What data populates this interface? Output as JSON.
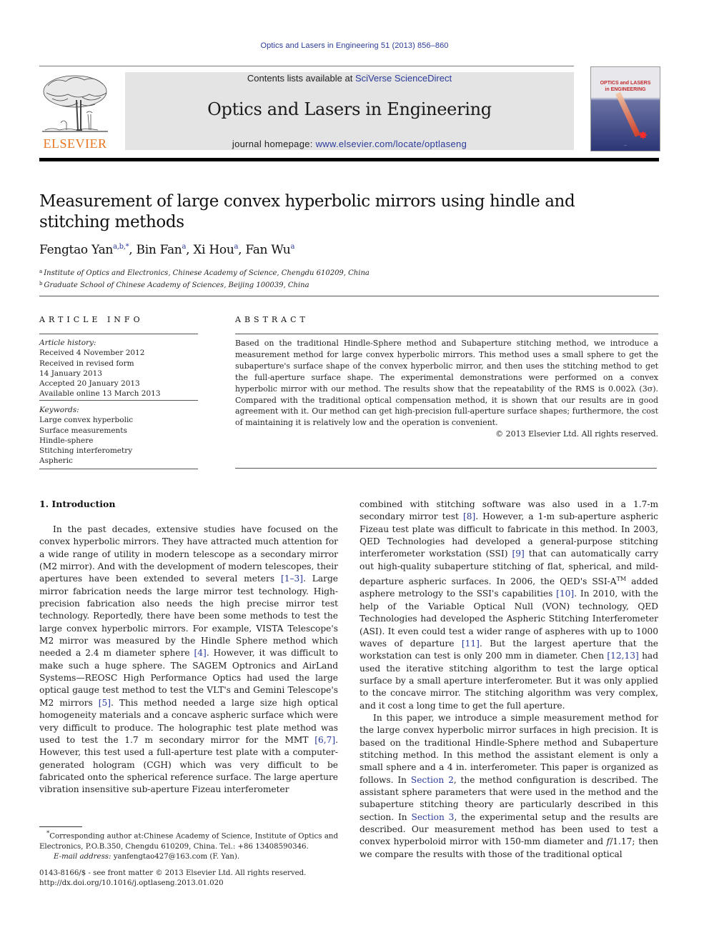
{
  "header": {
    "running_head": "Optics and Lasers in Engineering 51 (2013) 856–860",
    "publisher_logo_text": "ELSEVIER",
    "contents_prefix": "Contents lists available at ",
    "contents_link": "SciVerse ScienceDirect",
    "journal_title": "Optics and Lasers in Engineering",
    "homepage_prefix": "journal homepage: ",
    "homepage_link": "www.elsevier.com/locate/optlaseng",
    "cover": {
      "title_line1": "OPTICS and LASERS",
      "title_line2": "in ENGINEERING",
      "star_icon": "✸"
    },
    "colors": {
      "link": "#2a3a9a",
      "elsevier_orange": "#e87722",
      "banner_bg": "#e4e4e4"
    }
  },
  "article": {
    "title": "Measurement of large convex hyperbolic mirrors using hindle and stitching methods",
    "authors": [
      {
        "name": "Fengtao Yan",
        "sup": "a,b,",
        "star": "*"
      },
      {
        "name": "Bin Fan",
        "sup": "a"
      },
      {
        "name": "Xi Hou",
        "sup": "a"
      },
      {
        "name": "Fan Wu",
        "sup": "a"
      }
    ],
    "affiliations": [
      {
        "mark": "a",
        "text": "Institute of Optics and Electronics, Chinese Academy of Science, Chengdu 610209, China"
      },
      {
        "mark": "b",
        "text": "Graduate School of Chinese Academy of Sciences, Beijing 100039, China"
      }
    ]
  },
  "article_info": {
    "heading": "ARTICLE INFO",
    "history_label": "Article history:",
    "history": [
      "Received 4 November 2012",
      "Received in revised form",
      "14 January 2013",
      "Accepted 20 January 2013",
      "Available online 13 March 2013"
    ],
    "keywords_label": "Keywords:",
    "keywords": [
      "Large convex hyperbolic",
      "Surface measurements",
      "Hindle-sphere",
      "Stitching interferometry",
      "Aspheric"
    ]
  },
  "abstract": {
    "heading": "ABSTRACT",
    "text": "Based on the traditional Hindle-Sphere method and Subaperture stitching method, we introduce a measurement method for large convex hyperbolic mirrors. This method uses a small sphere to get the subaperture's surface shape of the convex hyperbolic mirror, and then uses the stitching method to get the full-aperture surface shape. The experimental demonstrations were performed on a convex hyperbolic mirror with our method. The results show that the repeatability of the RMS is 0.002λ (3σ). Compared with the traditional optical compensation method, it is shown that our results are in good agreement with it. Our method can get high-precision full-aperture surface shapes; furthermore, the cost of maintaining it is relatively low and the operation is convenient.",
    "copyright": "© 2013 Elsevier Ltd. All rights reserved."
  },
  "body": {
    "section_heading": "1.  Introduction",
    "left_column": [
      {
        "t": "In the past decades, extensive studies have focused on the convex hyperbolic mirrors. They have attracted much attention for a wide range of utility in modern telescope as a secondary mirror (M2 mirror). And with the development of modern telescopes, their apertures have been extended to several meters "
      },
      {
        "ref": "[1–3]"
      },
      {
        "t": ". Large mirror fabrication needs the large mirror test technology. High-precision fabrication also needs the high precise mirror test technology. Reportedly, there have been some methods to test the large convex hyperbolic mirrors. For example, VISTA Telescope's M2 mirror was measured by the Hindle Sphere method which needed a 2.4 m diameter sphere "
      },
      {
        "ref": "[4]"
      },
      {
        "t": ". However, it was difficult to make such a huge sphere. The SAGEM Optronics and AirLand Systems—REOSC High Performance Optics had used the large optical gauge test method to test the VLT's and Gemini Telescope's M2 mirrors "
      },
      {
        "ref": "[5]"
      },
      {
        "t": ". This method needed a large size high optical homogeneity materials and a concave aspheric surface which were very difficult to produce. The holographic test plate method was used to test the 1.7 m secondary mirror for the MMT "
      },
      {
        "ref": "[6,7]"
      },
      {
        "t": ". However, this test used a full-aperture test plate with a computer-generated hologram (CGH) which was very difficult to be fabricated onto the spherical reference surface. The large aperture vibration insensitive sub-aperture Fizeau interferometer"
      }
    ],
    "right_para1": [
      {
        "t": "combined with stitching software was also used in a 1.7-m secondary mirror test "
      },
      {
        "ref": "[8]"
      },
      {
        "t": ". However, a 1-m sub-aperture aspheric Fizeau test plate was difficult to fabricate in this method. In 2003, QED Technologies had developed a general-purpose stitching interferometer workstation (SSI) "
      },
      {
        "ref": "[9]"
      },
      {
        "t": " that can automatically carry out high-quality subaperture stitching of flat, spherical, and mild-departure aspheric surfaces. In 2006, the QED's SSI-A"
      },
      {
        "sup": "TM"
      },
      {
        "t": " added asphere metrology to the SSI's capabilities "
      },
      {
        "ref": "[10]"
      },
      {
        "t": ". In 2010, with the help of the Variable Optical Null (VON) technology, QED Technologies had developed the Aspheric Stitching Interferometer (ASI). It even could test a wider range of aspheres with up to 1000 waves of departure "
      },
      {
        "ref": "[11]"
      },
      {
        "t": ". But the largest aperture that the workstation can test is only 200 mm in diameter. Chen "
      },
      {
        "ref": "[12,13]"
      },
      {
        "t": " had used the iterative stitching algorithm to test the large optical surface by a small aperture interferometer. But it was only applied to the concave mirror. The stitching algorithm was very complex, and it cost a long time to get the full aperture."
      }
    ],
    "right_para2": [
      {
        "t": "In this paper, we introduce a simple measurement method for the large convex hyperbolic mirror surfaces in high precision. It is based on the traditional Hindle-Sphere method and Subaperture stitching method. In this method the assistant element is only a small sphere and a 4 in. interferometer. This paper is organized as follows. In "
      },
      {
        "ref": "Section 2"
      },
      {
        "t": ", the method configuration is described. The assistant sphere parameters that were used in the method and the subaperture stitching theory are particularly described in this section. In "
      },
      {
        "ref": "Section 3"
      },
      {
        "t": ", the experimental setup and the results are described. Our measurement method has been used to test a convex hyperboloid mirror with 150-mm diameter and "
      },
      {
        "i": "f"
      },
      {
        "t": "/1.17; then we compare the results with those of the traditional optical"
      }
    ]
  },
  "footnotes": {
    "corresponding_star": "*",
    "corresponding": "Corresponding author at:Chinese Academy of Science, Institute of Optics and Electronics, P.O.B.350, Chengdu 610209, China. Tel.: +86 13408590346.",
    "email_label": "E-mail address:",
    "email": "yanfengtao427@163.com (F. Yan).",
    "issn_line": "0143-8166/$ - see front matter © 2013 Elsevier Ltd. All rights reserved.",
    "doi": "http://dx.doi.org/10.1016/j.optlaseng.2013.01.020"
  }
}
